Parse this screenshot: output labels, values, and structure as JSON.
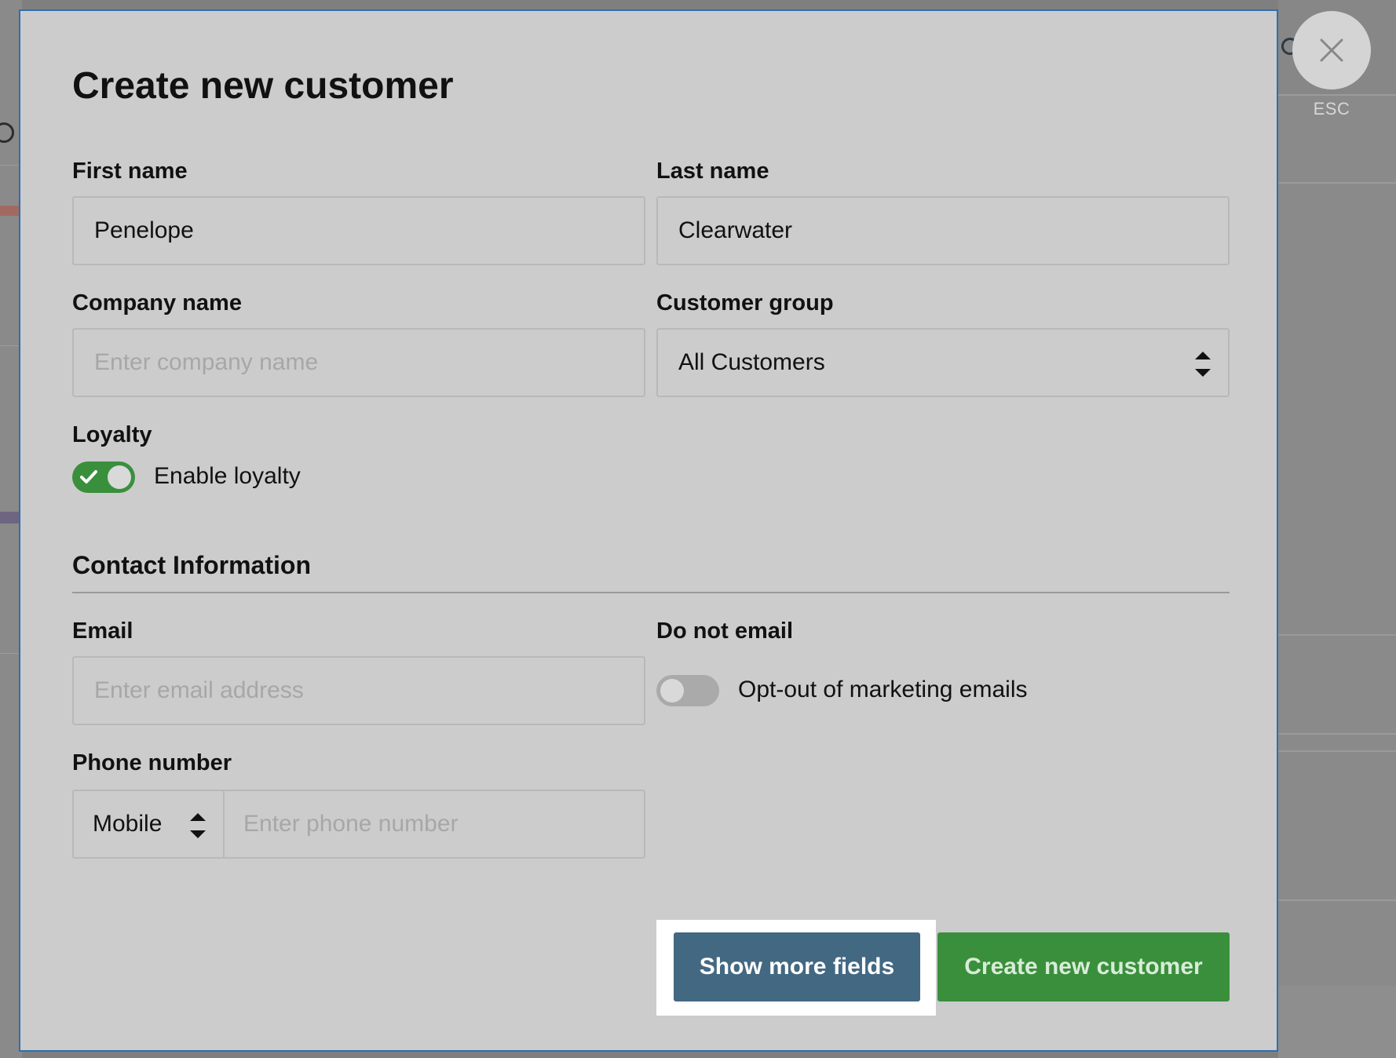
{
  "modal": {
    "title": "Create new customer",
    "close_hint": "ESC"
  },
  "fields": {
    "first_name": {
      "label": "First name",
      "value": "Penelope"
    },
    "last_name": {
      "label": "Last name",
      "value": "Clearwater"
    },
    "company_name": {
      "label": "Company name",
      "value": "",
      "placeholder": "Enter company name"
    },
    "customer_group": {
      "label": "Customer group",
      "selected": "All Customers"
    },
    "loyalty": {
      "label": "Loyalty",
      "toggle_text": "Enable loyalty",
      "enabled": true
    }
  },
  "contact": {
    "section_title": "Contact Information",
    "email": {
      "label": "Email",
      "value": "",
      "placeholder": "Enter email address"
    },
    "do_not_email": {
      "label": "Do not email",
      "toggle_text": "Opt-out of marketing emails",
      "enabled": false
    },
    "phone": {
      "label": "Phone number",
      "type": "Mobile",
      "value": "",
      "placeholder": "Enter phone number"
    }
  },
  "actions": {
    "show_more": "Show more fields",
    "create": "Create new customer"
  },
  "colors": {
    "accent_green": "#3a8f3c",
    "button_blue": "#436882",
    "modal_border": "#2f6fb0"
  }
}
